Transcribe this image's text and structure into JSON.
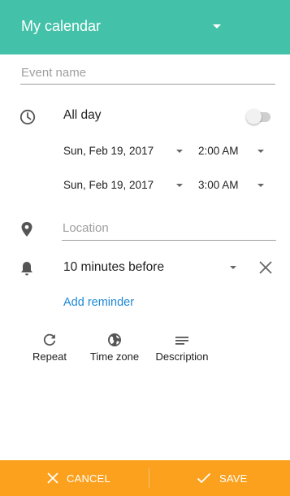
{
  "header": {
    "calendar_name": "My calendar"
  },
  "event": {
    "name_placeholder": "Event name"
  },
  "time": {
    "all_day_label": "All day",
    "all_day_on": false,
    "start_date": "Sun, Feb 19, 2017",
    "start_time": "2:00 AM",
    "end_date": "Sun, Feb 19, 2017",
    "end_time": "3:00 AM"
  },
  "location": {
    "placeholder": "Location"
  },
  "reminder": {
    "value": "10 minutes before",
    "add_label": "Add reminder"
  },
  "options": [
    {
      "label": "Repeat",
      "icon": "repeat-icon"
    },
    {
      "label": "Time zone",
      "icon": "globe-icon"
    },
    {
      "label": "Description",
      "icon": "description-icon"
    }
  ],
  "footer": {
    "cancel_label": "CANCEL",
    "save_label": "SAVE"
  },
  "colors": {
    "header": "#44c1a9",
    "footer": "#fba11e",
    "link": "#1e88d6"
  }
}
